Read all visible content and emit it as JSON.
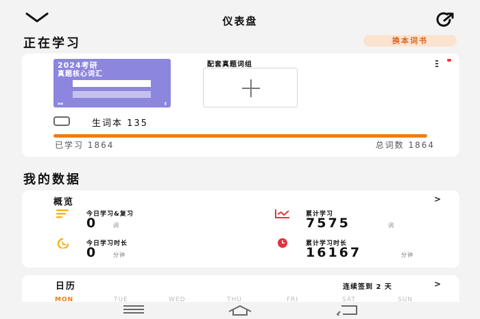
{
  "header": {
    "title": "仪表盘",
    "back_icon": "chevron-down-icon",
    "share_icon": "share-icon"
  },
  "studying": {
    "section_title": "正在学习",
    "switch_button": "换本词书",
    "book": {
      "title_line1": "2024考研",
      "title_line2": "真题核心词汇"
    },
    "pack_label": "配套真题词组",
    "vocab_notebook": "生词本 135",
    "progress_fraction": 1.0,
    "learned": "已学习 1864",
    "total": "总词数 1864"
  },
  "my_data": {
    "section_title": "我的数据",
    "overview_title": "概览",
    "stats": [
      {
        "label": "今日学习&复习",
        "value": "0",
        "unit": "词",
        "icon": "list-icon",
        "color": "#f3b51b"
      },
      {
        "label": "累计学习",
        "value": "7575",
        "unit": "词",
        "icon": "trend-chart-icon",
        "color": "#e3343c"
      },
      {
        "label": "今日学习时长",
        "value": "0",
        "unit": "分钟",
        "icon": "clock-icon",
        "color": "#f3b51b"
      },
      {
        "label": "累计学习时长",
        "value": "16167",
        "unit": "分钟",
        "icon": "clock-icon",
        "color": "#e3343c"
      }
    ]
  },
  "calendar": {
    "title": "日历",
    "streak": "连续签到 2 天",
    "weekdays": [
      "MON",
      "TUE",
      "WED",
      "THU",
      "FRI",
      "SAT",
      "SUN"
    ]
  },
  "colors": {
    "accent": "#f07c12",
    "book_cover": "#8c86de",
    "badge_bg": "#fbe3cf"
  }
}
